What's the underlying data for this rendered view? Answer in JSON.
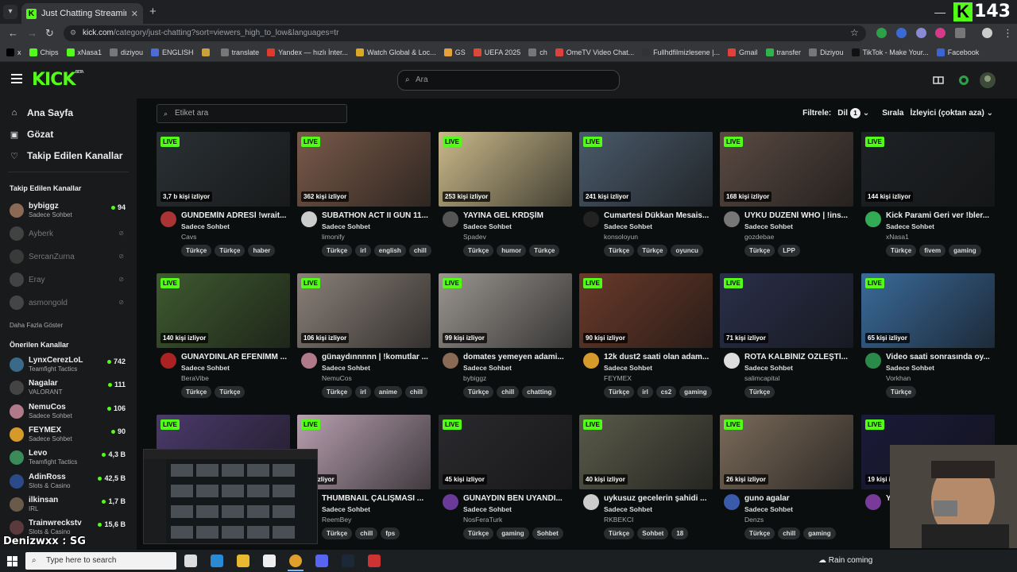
{
  "browser": {
    "tab_title": "Just Chatting Streaming - Live S",
    "tab_favicon": "K",
    "url_host": "kick.com",
    "url_path": "/category/just-chatting?sort=viewers_high_to_low&languages=tr",
    "overlay_count": "143",
    "bookmarks": [
      {
        "label": "x",
        "color": "#000000"
      },
      {
        "label": "Chips",
        "color": "#53fc18"
      },
      {
        "label": "xNasa1",
        "color": "#53fc18"
      },
      {
        "label": "diziyou",
        "color": "#777777"
      },
      {
        "label": "ENGLISH",
        "color": "#4a6cd4"
      },
      {
        "label": "",
        "color": "#c9a23a"
      },
      {
        "label": "translate",
        "color": "#777777"
      },
      {
        "label": "Yandex — hızlı İnter...",
        "color": "#e03a2f"
      },
      {
        "label": "Watch Global & Loc...",
        "color": "#d8a826"
      },
      {
        "label": "GS",
        "color": "#e6a23a"
      },
      {
        "label": "UEFA 2025",
        "color": "#d94a3a"
      },
      {
        "label": "ch",
        "color": "#777777"
      },
      {
        "label": "OmeTV Video Chat...",
        "color": "#e0413a"
      },
      {
        "label": "Fullhdfilmizlesene |...",
        "color": "#333333"
      },
      {
        "label": "Gmail",
        "color": "#e0413a"
      },
      {
        "label": "transfer",
        "color": "#2fb34a"
      },
      {
        "label": "Diziyou",
        "color": "#777777"
      },
      {
        "label": "TikTok - Make Your...",
        "color": "#111111"
      },
      {
        "label": "Facebook",
        "color": "#3b64d4"
      }
    ]
  },
  "header": {
    "logo": "KICK",
    "logo_sup": "BETA",
    "search_placeholder": "Ara"
  },
  "sidebar": {
    "nav": [
      {
        "label": "Ana Sayfa",
        "icon": "home-icon",
        "glyph": "⌂"
      },
      {
        "label": "Gözat",
        "icon": "browse-icon",
        "glyph": "▣"
      },
      {
        "label": "Takip Edilen Kanallar",
        "icon": "heart-icon",
        "glyph": "♡"
      }
    ],
    "followed_heading": "Takip Edilen Kanallar",
    "followed": [
      {
        "name": "bybiggz",
        "category": "Sadece Sohbet",
        "count": "94",
        "online": true,
        "color": "#8a6a55"
      },
      {
        "name": "Ayberk",
        "category": "",
        "count": "",
        "online": false,
        "color": "#6a6a6a"
      },
      {
        "name": "SercanZurna",
        "category": "",
        "count": "",
        "online": false,
        "color": "#5a5a5a"
      },
      {
        "name": "Eray",
        "category": "",
        "count": "",
        "online": false,
        "color": "#6b6b6b"
      },
      {
        "name": "asmongold",
        "category": "",
        "count": "",
        "online": false,
        "color": "#707070"
      }
    ],
    "show_more": "Daha Fazla Göster",
    "recommended_heading": "Önerilen Kanallar",
    "recommended": [
      {
        "name": "LynxCerezLoL",
        "category": "Teamfight Tactics",
        "count": "742",
        "color": "#3a6a8a"
      },
      {
        "name": "Nagalar",
        "category": "VALORANT",
        "count": "111",
        "color": "#444444"
      },
      {
        "name": "NemuCos",
        "category": "Sadece Sohbet",
        "count": "106",
        "color": "#b07a8a"
      },
      {
        "name": "FEYMEX",
        "category": "Sadece Sohbet",
        "count": "90",
        "color": "#d69a2a"
      },
      {
        "name": "Levo",
        "category": "Teamfight Tactics",
        "count": "4,3 B",
        "color": "#3a8a5a"
      },
      {
        "name": "AdinRoss",
        "category": "Slots & Casino",
        "count": "42,5 B",
        "color": "#2a4a8a"
      },
      {
        "name": "ilkinsan",
        "category": "IRL",
        "count": "1,7 B",
        "color": "#6a5a4a"
      },
      {
        "name": "Trainwreckstv",
        "category": "Slots & Casino",
        "count": "15,6 B",
        "color": "#5a3a3a"
      }
    ]
  },
  "main": {
    "tag_search_placeholder": "Etiket ara",
    "filter_label": "Filtrele:",
    "language_label": "Dil",
    "language_count": "1",
    "sort_label": "Sırala",
    "sort_value": "İzleyici (çoktan aza)",
    "live_badge": "LIVE",
    "cards": [
      {
        "viewers": "3,7 b kişi izliyor",
        "title": "GÜNDEMİN ADRESİ !wrait...",
        "category": "Sadece Sohbet",
        "channel": "Cavs",
        "tags": [
          "Türkçe",
          "Türkçe",
          "haber"
        ],
        "thumb": "#2a3034",
        "avatar": "#a33"
      },
      {
        "viewers": "362 kişi izliyor",
        "title": "SUBATHON ACT II GÜN 11...",
        "category": "Sadece Sohbet",
        "channel": "limonify",
        "tags": [
          "Türkçe",
          "irl",
          "english",
          "chill"
        ],
        "thumb": "#7a5a4a",
        "avatar": "#ccc"
      },
      {
        "viewers": "253 kişi izliyor",
        "title": "YAYINA GEL KRDŞİM",
        "category": "Sadece Sohbet",
        "channel": "Spadev",
        "tags": [
          "Türkçe",
          "humor",
          "Türkçe"
        ],
        "thumb": "#c9b98a",
        "avatar": "#555"
      },
      {
        "viewers": "241 kişi izliyor",
        "title": "Cumartesi Dükkan Mesais...",
        "category": "Sadece Sohbet",
        "channel": "konsoloyun",
        "tags": [
          "Türkçe",
          "Türkçe",
          "oyuncu"
        ],
        "thumb": "#4a5a6a",
        "avatar": "#222"
      },
      {
        "viewers": "168 kişi izliyor",
        "title": "UYKU DÜZENİ WHO | !ins...",
        "category": "Sadece Sohbet",
        "channel": "gozdebae",
        "tags": [
          "Türkçe",
          "LPP"
        ],
        "thumb": "#5a4a42",
        "avatar": "#777"
      },
      {
        "viewers": "144 kişi izliyor",
        "title": "Kick Parami Geri ver !bler...",
        "category": "Sadece Sohbet",
        "channel": "xNasa1",
        "tags": [
          "Türkçe",
          "fivem",
          "gaming"
        ],
        "thumb": "#1e2226",
        "avatar": "#3a5"
      },
      {
        "viewers": "140 kişi izliyor",
        "title": "GÜNAYDINLAR EFENİMM ...",
        "category": "Sadece Sohbet",
        "channel": "BeraVibe",
        "tags": [
          "Türkçe",
          "Türkçe"
        ],
        "thumb": "#3f5a30",
        "avatar": "#a22"
      },
      {
        "viewers": "106 kişi izliyor",
        "title": "günaydınnnnn | !komutlar ...",
        "category": "Sadece Sohbet",
        "channel": "NemuCos",
        "tags": [
          "Türkçe",
          "irl",
          "anime",
          "chill"
        ],
        "thumb": "#8a8078",
        "avatar": "#b07a8a"
      },
      {
        "viewers": "99 kişi izliyor",
        "title": "domates yemeyen adami...",
        "category": "Sadece Sohbet",
        "channel": "bybiggz",
        "tags": [
          "Türkçe",
          "chill",
          "chatting"
        ],
        "thumb": "#9a9590",
        "avatar": "#8a6a55"
      },
      {
        "viewers": "90 kişi izliyor",
        "title": "12k dust2 saati olan adam...",
        "category": "Sadece Sohbet",
        "channel": "FEYMEX",
        "tags": [
          "Türkçe",
          "irl",
          "cs2",
          "gaming"
        ],
        "thumb": "#6a3a2a",
        "avatar": "#d69a2a"
      },
      {
        "viewers": "71 kişi izliyor",
        "title": "ROTA KALBİNİZ ÖZLEŞTİ...",
        "category": "Sadece Sohbet",
        "channel": "salimcapital",
        "tags": [
          "Türkçe"
        ],
        "thumb": "#2a2f4a",
        "avatar": "#ddd"
      },
      {
        "viewers": "65 kişi izliyor",
        "title": "Video saati sonrasında oy...",
        "category": "Sadece Sohbet",
        "channel": "Vorkhan",
        "tags": [
          "Türkçe"
        ],
        "thumb": "#3a6a9a",
        "avatar": "#2a8a4a"
      },
      {
        "viewers": "",
        "title": "",
        "category": "",
        "channel": "",
        "tags": [],
        "thumb": "#4a3a6a",
        "avatar": "#0000"
      },
      {
        "viewers": "kişi izliyor",
        "title": "THUMBNAIL ÇALIŞMASI ...",
        "category": "Sadece Sohbet",
        "channel": "ReemBey",
        "tags": [
          "Türkçe",
          "chill",
          "fps"
        ],
        "thumb": "#b8a0b0",
        "avatar": "#0000"
      },
      {
        "viewers": "45 kişi izliyor",
        "title": "GÜNAYDIN BEN UYANDI...",
        "category": "Sadece Sohbet",
        "channel": "NosFeraTurk",
        "tags": [
          "Türkçe",
          "gaming",
          "Sohbet"
        ],
        "thumb": "#2a2a2e",
        "avatar": "#6a3a9a"
      },
      {
        "viewers": "40 kişi izliyor",
        "title": "uykusuz gecelerin şahidi ...",
        "category": "Sadece Sohbet",
        "channel": "RKBEKCI",
        "tags": [
          "Türkçe",
          "Sohbet",
          "18"
        ],
        "thumb": "#5a5a4a",
        "avatar": "#ccc"
      },
      {
        "viewers": "26 kişi izliyor",
        "title": "guno agalar",
        "category": "Sadece Sohbet",
        "channel": "Denzs",
        "tags": [
          "Türkçe",
          "chill",
          "gaming"
        ],
        "thumb": "#7a6a5a",
        "avatar": "#3a5aaa"
      },
      {
        "viewers": "19 kişi i",
        "title": "Y",
        "category": "",
        "channel": "",
        "tags": [],
        "thumb": "#1a1a3a",
        "avatar": "#7a3a9a"
      }
    ]
  },
  "overlay": {
    "streamer_name": "Denizwxx : SG"
  },
  "taskbar": {
    "search_placeholder": "Type here to search",
    "weather": "Rain coming",
    "apps": [
      {
        "name": "task-view-icon",
        "color": "#dddddd"
      },
      {
        "name": "edge-icon",
        "color": "#2a8ad4"
      },
      {
        "name": "file-explorer-icon",
        "color": "#e8b930"
      },
      {
        "name": "store-icon",
        "color": "#eeeeee"
      },
      {
        "name": "chrome-icon",
        "color": "#e0a02a"
      },
      {
        "name": "discord-icon",
        "color": "#5865f2"
      },
      {
        "name": "steam-icon",
        "color": "#1b2838"
      },
      {
        "name": "app-icon",
        "color": "#c33"
      }
    ]
  }
}
